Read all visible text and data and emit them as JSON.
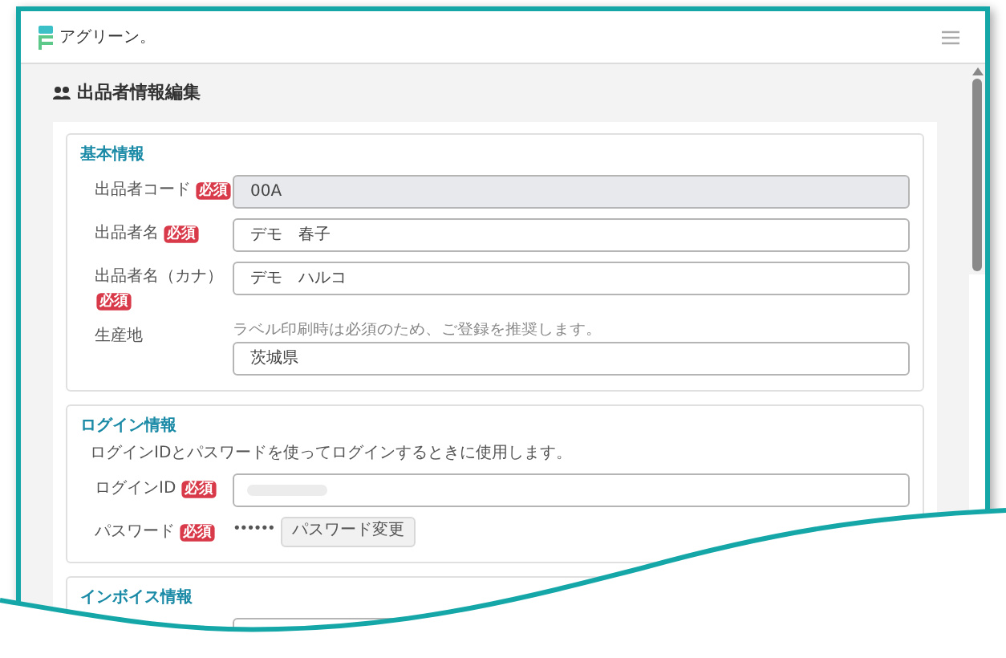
{
  "header": {
    "logo_text": "アグリーン。"
  },
  "page_title": "出品者情報編集",
  "sections": [
    {
      "title": "基本情報",
      "fields": [
        {
          "kind": "text",
          "label": "出品者コード",
          "badge": "必須",
          "value": "00A",
          "disabled": true
        },
        {
          "kind": "text",
          "label": "出品者名",
          "badge": "必須",
          "value": "デモ　春子",
          "disabled": false
        },
        {
          "kind": "text",
          "label": "出品者名（カナ）",
          "badge": "必須",
          "value": "デモ　ハルコ",
          "disabled": false
        },
        {
          "kind": "text",
          "label": "生産地",
          "hint": "ラベル印刷時は必須のため、ご登録を推奨します。",
          "value": "茨城県",
          "disabled": false
        }
      ]
    },
    {
      "title": "ログイン情報",
      "description": "ログインIDとパスワードを使ってログインするときに使用します。",
      "fields": [
        {
          "kind": "redacted",
          "label": "ログインID",
          "badge": "必須"
        },
        {
          "kind": "password",
          "label": "パスワード",
          "badge": "必須",
          "value": "••••••",
          "button": "パスワード変更"
        }
      ]
    },
    {
      "title": "インボイス情報",
      "fields": [
        {
          "kind": "text"
        }
      ]
    }
  ]
}
